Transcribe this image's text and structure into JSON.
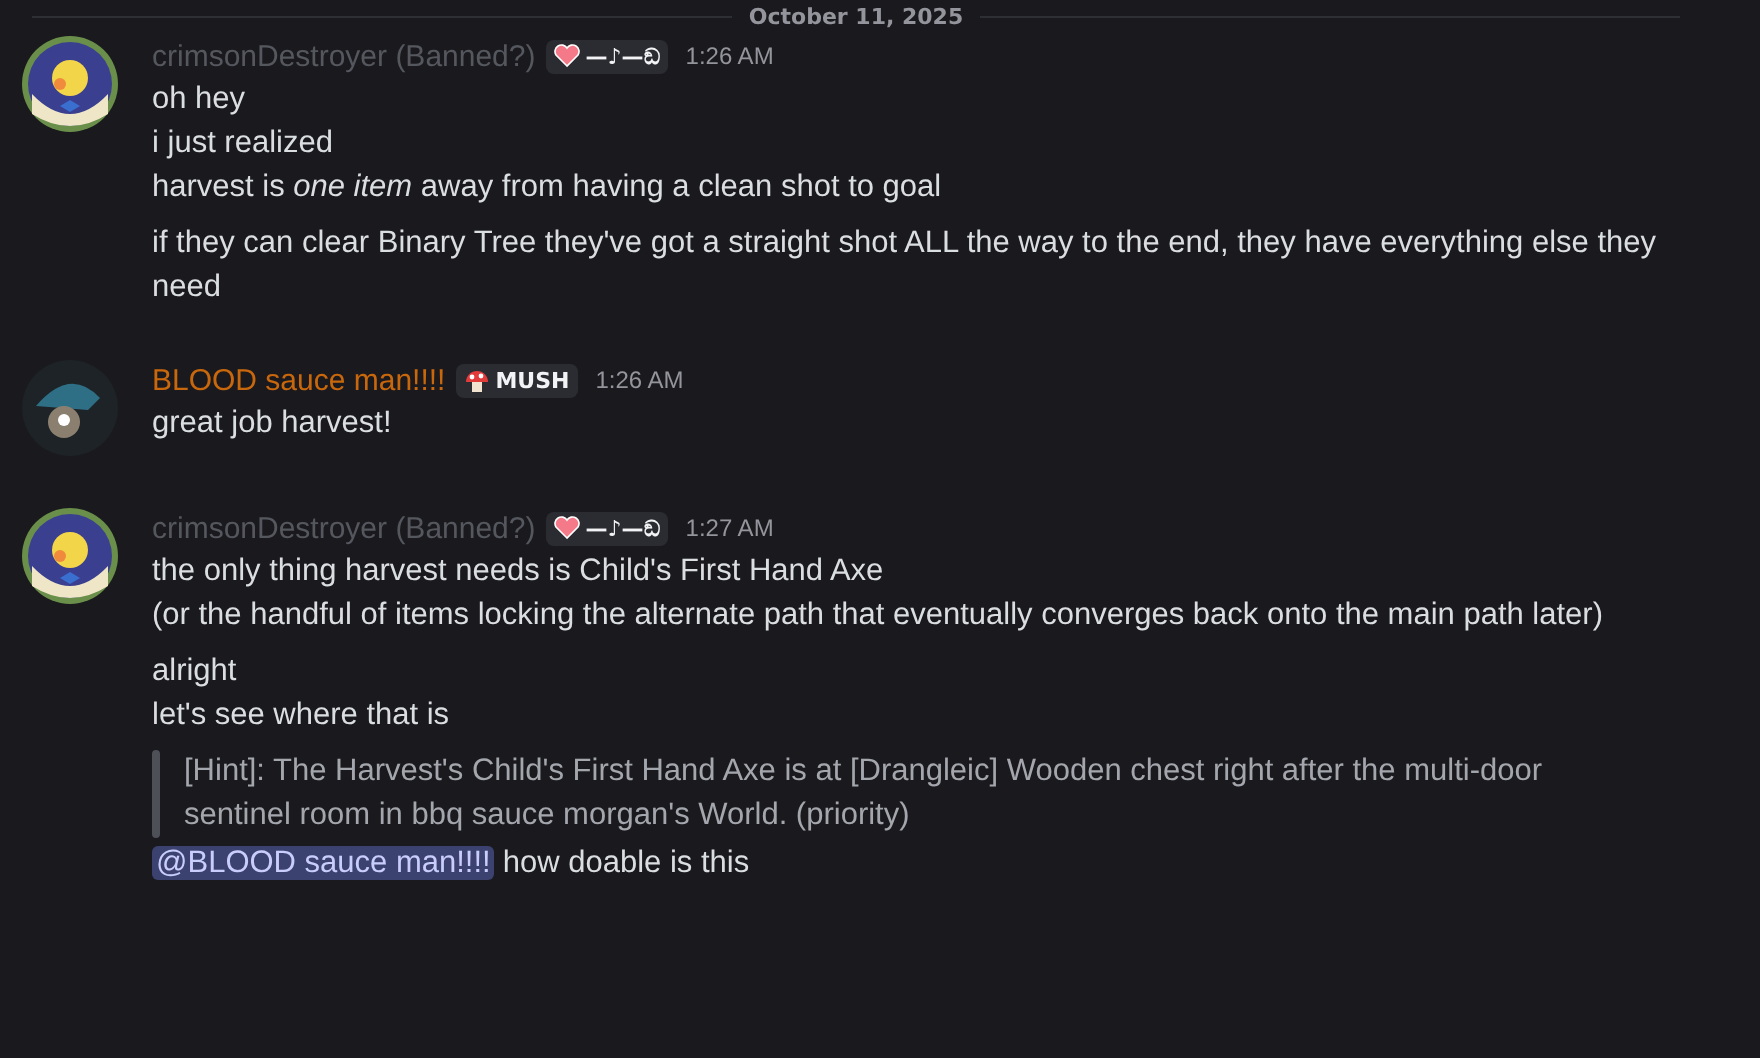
{
  "date_divider": "October 11, 2025",
  "messages": [
    {
      "kind": "bird",
      "author": "crimsonDestroyer (Banned?)",
      "color": "#55575e",
      "tag": {
        "kind": "heart",
        "label": "—♪—ඞ"
      },
      "time": "1:26 AM",
      "lines": [
        {
          "kind": "text",
          "text": "oh hey"
        },
        {
          "kind": "text",
          "text": "i just realized"
        },
        {
          "kind": "text",
          "text": "harvest is *one item* away from having a clean shot to goal"
        },
        {
          "kind": "text",
          "gap": true,
          "text": "if they can clear Binary Tree they've got a straight shot ALL the way to the end, they have everything else they need"
        }
      ]
    },
    {
      "kind": "hat",
      "author": "BLOOD sauce man!!!!",
      "color": "#c9670c",
      "tag": {
        "kind": "mushroom",
        "label": "MUSH"
      },
      "time": "1:26 AM",
      "lines": [
        {
          "kind": "text",
          "text": "great job harvest!"
        }
      ]
    },
    {
      "kind": "bird",
      "author": "crimsonDestroyer (Banned?)",
      "color": "#55575e",
      "tag": {
        "kind": "heart",
        "label": "—♪—ඞ"
      },
      "time": "1:27 AM",
      "lines": [
        {
          "kind": "text",
          "text": "the only thing harvest needs is Child's First Hand Axe"
        },
        {
          "kind": "text",
          "text": "(or the handful of items locking the alternate path that eventually converges back onto the main path later)"
        },
        {
          "kind": "text",
          "gap": true,
          "text": "alright"
        },
        {
          "kind": "text",
          "text": "let's see where that is"
        },
        {
          "kind": "quote",
          "gap": true,
          "text": "[Hint]: The Harvest's Child's First Hand Axe is at [Drangleic] Wooden chest right after the multi-door sentinel room in bbq sauce morgan's World. (priority)"
        },
        {
          "kind": "mention",
          "mention": "@BLOOD sauce man!!!!",
          "text": "how doable is this"
        }
      ]
    }
  ]
}
